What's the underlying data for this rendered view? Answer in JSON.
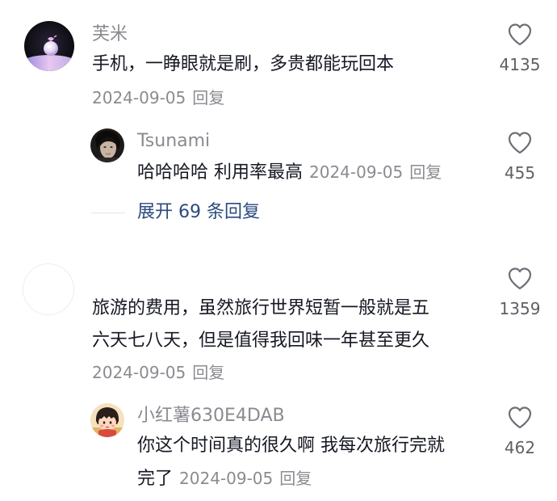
{
  "comments": [
    {
      "username": "芙米",
      "avatar": "crystal-ball-avatar",
      "text_lines": [
        "手机，一睁眼就是刷，多贵都能玩回本"
      ],
      "date": "2024-09-05",
      "reply_label": "回复",
      "likes": "4135",
      "replies": [
        {
          "username": "Tsunami",
          "avatar": "portrait-avatar",
          "text": "哈哈哈哈 利用率最高",
          "date": "2024-09-05",
          "reply_label": "回复",
          "likes": "455"
        }
      ],
      "expand_label": "展开 69 条回复"
    },
    {
      "username": "",
      "avatar": "blank-avatar",
      "text_lines": [
        "旅游的费用，虽然旅行世界短暂一般就是五",
        "六天七八天，但是值得我回味一年甚至更久"
      ],
      "date": "2024-09-05",
      "reply_label": "回复",
      "likes": "1359",
      "replies": [
        {
          "username": "小红薯630E4DAB",
          "avatar": "cartoon-girl-avatar",
          "text_lines": [
            "你这个时间真的很久啊 我每次旅行完就",
            "完了"
          ],
          "date": "2024-09-05",
          "reply_label": "回复",
          "likes": "462"
        }
      ]
    }
  ],
  "icons": {
    "like": "heart-outline-icon"
  },
  "colors": {
    "text": "#161823",
    "secondary": "#8a8b91",
    "link": "#2b4a7e"
  }
}
